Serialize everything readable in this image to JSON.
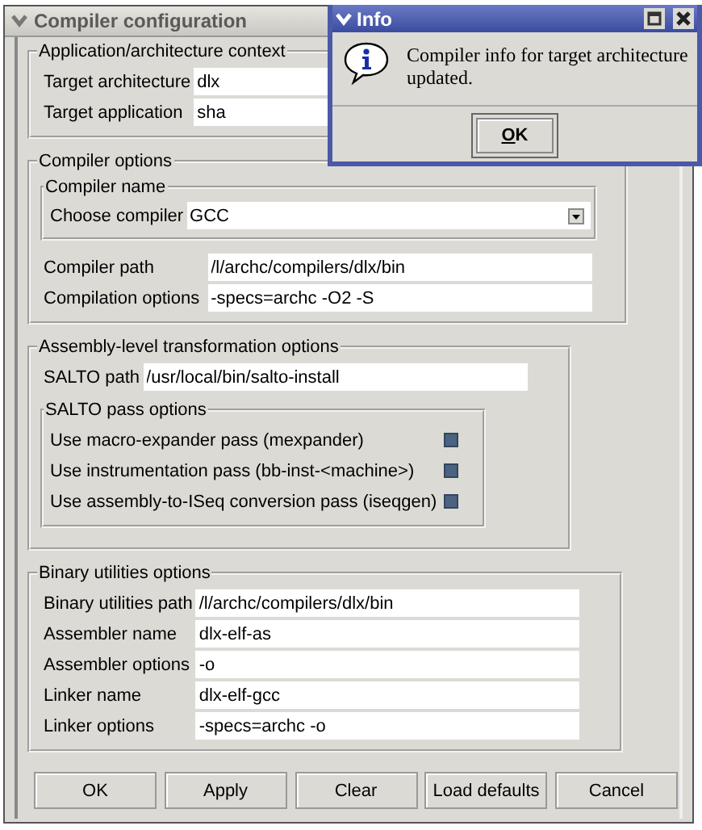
{
  "main_window": {
    "title": "Compiler configuration",
    "groups": [
      {
        "title": "Application/architecture context",
        "items": [
          {
            "kind": "field",
            "label": "Target architecture",
            "value": "dlx"
          },
          {
            "kind": "field",
            "label": "Target application",
            "value": "sha"
          }
        ]
      },
      {
        "title": "Compiler options",
        "items": [
          {
            "kind": "group",
            "title": "Compiler name",
            "items": [
              {
                "kind": "combo",
                "label": "Choose compiler",
                "value": "GCC"
              }
            ]
          },
          {
            "kind": "field",
            "label": "Compiler path",
            "value": "/l/archc/compilers/dlx/bin"
          },
          {
            "kind": "field",
            "label": "Compilation options",
            "value": "-specs=archc -O2 -S"
          }
        ]
      },
      {
        "title": "Assembly-level transformation options",
        "items": [
          {
            "kind": "field",
            "label": "SALTO path",
            "value": "/usr/local/bin/salto-install"
          },
          {
            "kind": "group",
            "title": "SALTO pass options",
            "items": [
              {
                "kind": "check",
                "label": "Use macro-expander pass (mexpander)",
                "checked": true
              },
              {
                "kind": "check",
                "label": "Use instrumentation pass (bb-inst-<machine>)",
                "checked": true
              },
              {
                "kind": "check",
                "label": "Use assembly-to-ISeq conversion pass (iseqgen)",
                "checked": true
              }
            ]
          }
        ]
      },
      {
        "title": "Binary utilities options",
        "items": [
          {
            "kind": "field",
            "label": "Binary utilities path",
            "value": "/l/archc/compilers/dlx/bin"
          },
          {
            "kind": "field",
            "label": "Assembler name",
            "value": "dlx-elf-as"
          },
          {
            "kind": "field",
            "label": "Assembler options",
            "value": "-o"
          },
          {
            "kind": "field",
            "label": "Linker name",
            "value": "dlx-elf-gcc"
          },
          {
            "kind": "field",
            "label": "Linker options",
            "value": "-specs=archc -o"
          }
        ]
      }
    ],
    "buttons": [
      "OK",
      "Apply",
      "Clear",
      "Load defaults",
      "Cancel"
    ]
  },
  "info_dialog": {
    "title": "Info",
    "message": "Compiler info for target architecture updated.",
    "button": "OK"
  }
}
